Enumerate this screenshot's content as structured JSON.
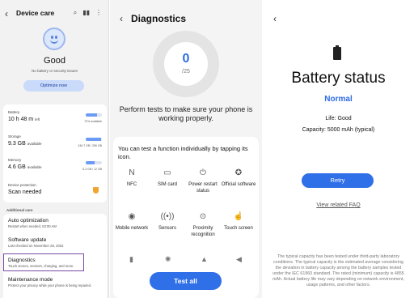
{
  "device_care": {
    "title": "Device care",
    "status": "Good",
    "subtitle": "No battery or security issues",
    "optimize_label": "Optimize now",
    "battery": {
      "label": "Battery",
      "value": "10 h 48 m",
      "unit": "left",
      "note": "72% available",
      "fraction": 0.72
    },
    "storage": {
      "label": "Storage",
      "value": "9.3 GB",
      "unit": "available",
      "note": "246.7 GB / 256 GB",
      "fraction": 0.96
    },
    "memory": {
      "label": "Memory",
      "value": "4.6 GB",
      "unit": "available",
      "note": "6.3 GB / 12 GB",
      "fraction": 0.53
    },
    "protection": {
      "label": "Device protection",
      "value": "Scan needed"
    },
    "additional_care_heading": "Additional care",
    "auto_opt": {
      "title": "Auto optimization",
      "desc": "Restart when needed, 03:00 AM"
    },
    "software_update": {
      "title": "Software update",
      "desc": "Last checked on November 26, 2022"
    },
    "diagnostics": {
      "title": "Diagnostics",
      "desc": "Touch screen, sensors, charging, and more."
    },
    "maintenance": {
      "title": "Maintenance mode",
      "desc": "Protect your privacy while your phone is being repaired."
    }
  },
  "diagnostics": {
    "title": "Diagnostics",
    "score": "0",
    "score_total": "/25",
    "description": "Perform tests to make sure your phone is working properly.",
    "hint": "You can test a function individually by tapping its icon.",
    "functions": [
      {
        "icon": "nfc-icon",
        "glyph": "N",
        "label": "NFC"
      },
      {
        "icon": "sim-card-icon",
        "glyph": "▭",
        "label": "SIM card"
      },
      {
        "icon": "power-icon",
        "glyph": "⏻",
        "label": "Power restart status"
      },
      {
        "icon": "software-badge-icon",
        "glyph": "✪",
        "label": "Official software"
      },
      {
        "icon": "mobile-network-icon",
        "glyph": "◉",
        "label": "Mobile network"
      },
      {
        "icon": "sensors-icon",
        "glyph": "((•))",
        "label": "Sensors"
      },
      {
        "icon": "proximity-icon",
        "glyph": "⊙",
        "label": "Proximity recognition"
      },
      {
        "icon": "touch-screen-icon",
        "glyph": "☝",
        "label": "Touch screen"
      }
    ],
    "test_all_label": "Test all"
  },
  "battery_status": {
    "title": "Battery status",
    "status": "Normal",
    "life": "Life: Good",
    "capacity": "Capacity: 5000 mAh (typical)",
    "retry_label": "Retry",
    "faq_label": "View related FAQ",
    "disclaimer": "The typical capacity has been tested under third-party laboratory conditions. The typical capacity is the estimated average considering the deviation in battery capacity among the battery samples tested under the IEC 61960 standard. The rated (minimum) capacity is 4855 mAh. Actual battery life may vary depending on network environment, usage patterns, and other factors."
  },
  "colors": {
    "accent": "#2f6fe8",
    "warning": "#f0a531",
    "highlight_border": "#7a4aa4"
  }
}
